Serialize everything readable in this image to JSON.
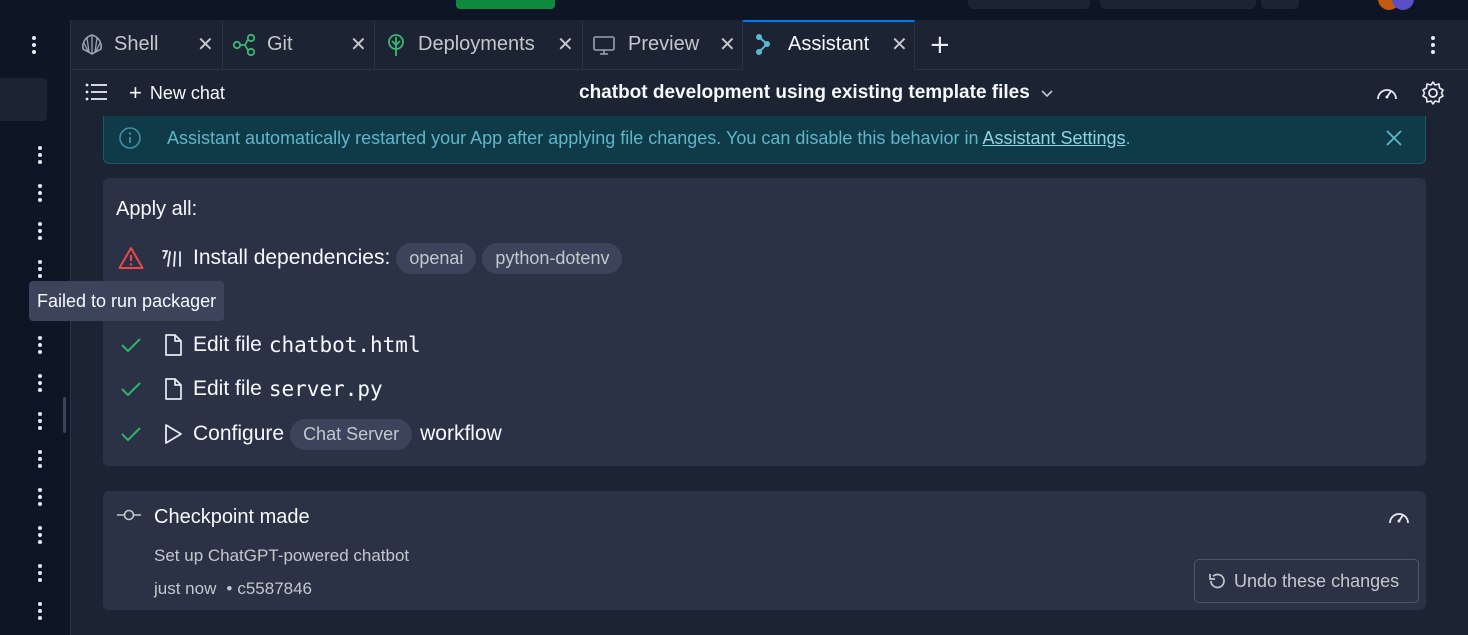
{
  "tabs": [
    {
      "label": "Shell",
      "icon": "shell-icon"
    },
    {
      "label": "Git",
      "icon": "git-icon"
    },
    {
      "label": "Deployments",
      "icon": "deployments-icon"
    },
    {
      "label": "Preview",
      "icon": "monitor-icon"
    },
    {
      "label": "Assistant",
      "icon": "assistant-icon",
      "active": true
    }
  ],
  "toolbar": {
    "new_chat_label": "New chat",
    "chat_title": "chatbot development using existing template files"
  },
  "banner": {
    "text": "Assistant automatically restarted your App after applying file changes. You can disable this behavior in ",
    "link": "Assistant Settings",
    "suffix": "."
  },
  "apply": {
    "title": "Apply all:",
    "install": {
      "label": "Install dependencies:",
      "packages": [
        "openai",
        "python-dotenv"
      ],
      "status": "error"
    },
    "edits": [
      {
        "label": "Edit file",
        "file": "chatbot.html",
        "status": "done"
      },
      {
        "label": "Edit file",
        "file": "server.py",
        "status": "done"
      }
    ],
    "configure": {
      "label": "Configure",
      "workflow": "Chat Server",
      "suffix": "workflow",
      "status": "done"
    }
  },
  "tooltip": "Failed to run packager",
  "checkpoint": {
    "title": "Checkpoint made",
    "description": "Set up ChatGPT-powered chatbot",
    "time": "just now",
    "separator": "•",
    "hash": "c5587846",
    "undo_label": "Undo these changes"
  },
  "colors": {
    "accent": "#0079f2",
    "success": "#2fb36b",
    "error": "#e5484d",
    "banner_bg": "#0f3a47"
  }
}
